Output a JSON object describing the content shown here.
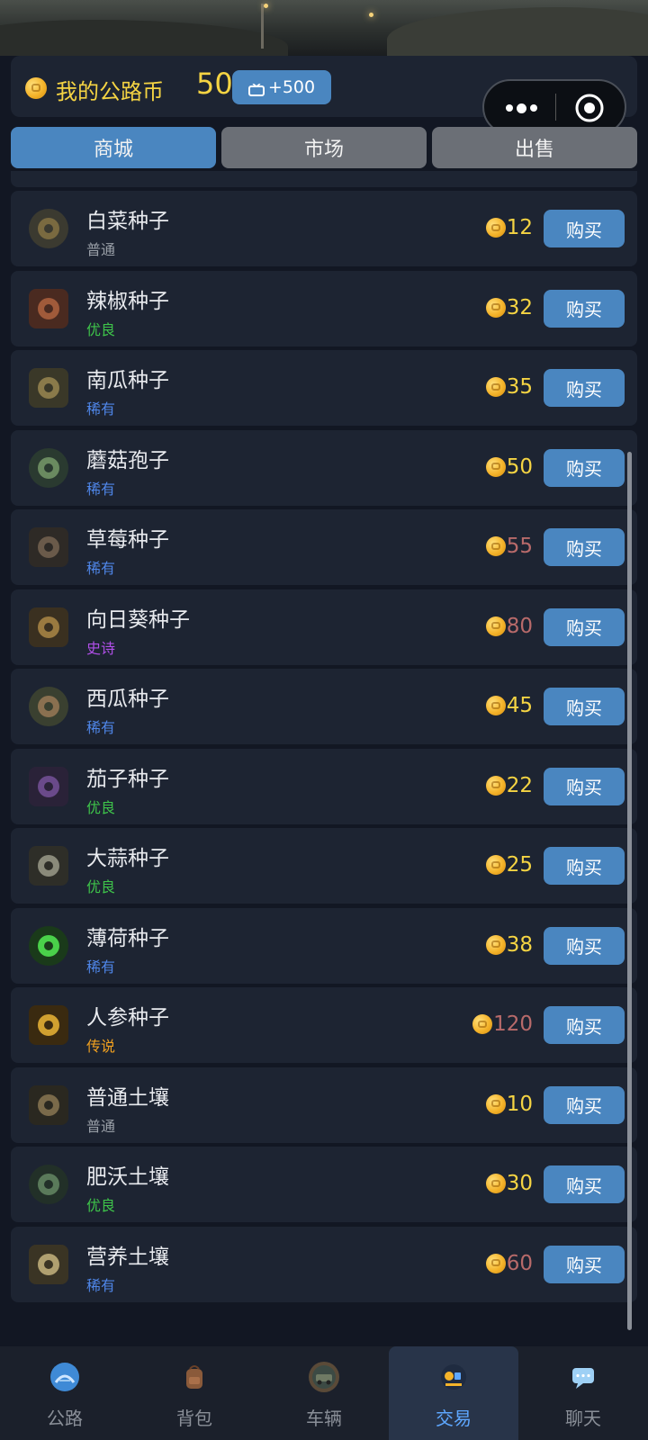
{
  "wallet": {
    "label": "我的公路币",
    "amount": "50",
    "ad_reward": "+500"
  },
  "tabs": [
    {
      "label": "商城",
      "active": true
    },
    {
      "label": "市场",
      "active": false
    },
    {
      "label": "出售",
      "active": false
    }
  ],
  "items": [
    {
      "name": "白菜种子",
      "rarity": "普通",
      "rarity_color": "#9aa0a8",
      "price": "12",
      "price_color": "#f5d443",
      "icon": "cabbage-seed-icon"
    },
    {
      "name": "辣椒种子",
      "rarity": "优良",
      "rarity_color": "#3ec44a",
      "price": "32",
      "price_color": "#f5d443",
      "icon": "chili-seed-icon"
    },
    {
      "name": "南瓜种子",
      "rarity": "稀有",
      "rarity_color": "#4f86e8",
      "price": "35",
      "price_color": "#f5d443",
      "icon": "pumpkin-seed-icon"
    },
    {
      "name": "蘑菇孢子",
      "rarity": "稀有",
      "rarity_color": "#4f86e8",
      "price": "50",
      "price_color": "#f5d443",
      "icon": "mushroom-spore-icon"
    },
    {
      "name": "草莓种子",
      "rarity": "稀有",
      "rarity_color": "#4f86e8",
      "price": "55",
      "price_color": "#b86a6a",
      "icon": "strawberry-seed-icon"
    },
    {
      "name": "向日葵种子",
      "rarity": "史诗",
      "rarity_color": "#b04fe8",
      "price": "80",
      "price_color": "#b86a6a",
      "icon": "sunflower-seed-icon"
    },
    {
      "name": "西瓜种子",
      "rarity": "稀有",
      "rarity_color": "#4f86e8",
      "price": "45",
      "price_color": "#f5d443",
      "icon": "watermelon-seed-icon"
    },
    {
      "name": "茄子种子",
      "rarity": "优良",
      "rarity_color": "#3ec44a",
      "price": "22",
      "price_color": "#f5d443",
      "icon": "eggplant-seed-icon"
    },
    {
      "name": "大蒜种子",
      "rarity": "优良",
      "rarity_color": "#3ec44a",
      "price": "25",
      "price_color": "#f5d443",
      "icon": "garlic-seed-icon"
    },
    {
      "name": "薄荷种子",
      "rarity": "稀有",
      "rarity_color": "#4f86e8",
      "price": "38",
      "price_color": "#f5d443",
      "icon": "mint-seed-icon"
    },
    {
      "name": "人参种子",
      "rarity": "传说",
      "rarity_color": "#f0a020",
      "price": "120",
      "price_color": "#b86a6a",
      "icon": "ginseng-seed-icon"
    },
    {
      "name": "普通土壤",
      "rarity": "普通",
      "rarity_color": "#9aa0a8",
      "price": "10",
      "price_color": "#f5d443",
      "icon": "common-soil-icon"
    },
    {
      "name": "肥沃土壤",
      "rarity": "优良",
      "rarity_color": "#3ec44a",
      "price": "30",
      "price_color": "#f5d443",
      "icon": "fertile-soil-icon"
    },
    {
      "name": "营养土壤",
      "rarity": "稀有",
      "rarity_color": "#4f86e8",
      "price": "60",
      "price_color": "#b86a6a",
      "icon": "nutrient-soil-icon"
    }
  ],
  "buy_label": "购买",
  "nav": [
    {
      "label": "公路",
      "icon": "road-icon",
      "active": false
    },
    {
      "label": "背包",
      "icon": "backpack-icon",
      "active": false
    },
    {
      "label": "车辆",
      "icon": "vehicle-icon",
      "active": false
    },
    {
      "label": "交易",
      "icon": "trade-icon",
      "active": true
    },
    {
      "label": "聊天",
      "icon": "chat-icon",
      "active": false
    }
  ],
  "colors": {
    "accent": "#4a86c0",
    "gold": "#f5d443",
    "card": "#1d2432",
    "background": "#121723"
  }
}
